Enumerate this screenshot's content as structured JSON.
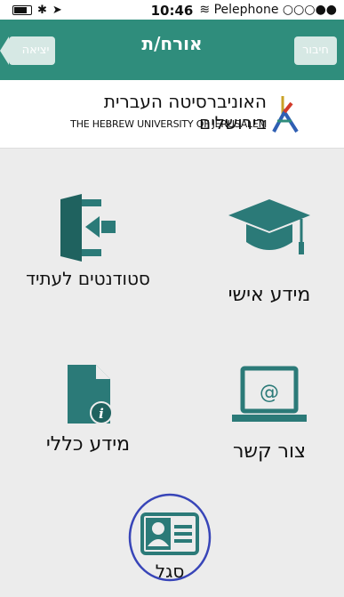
{
  "status": {
    "time": "10:46",
    "carrier": "Pelephone ○○○●●"
  },
  "nav": {
    "title": "אורח/ת",
    "back_label": "יציאה",
    "login_label": "חיבור"
  },
  "header": {
    "heb_name": "האוניברסיטה העברית בירושלים",
    "eng_name": "THE HEBREW UNIVERSITY OF JERUSALEM"
  },
  "tiles": {
    "personal_info": "מידע אישי",
    "future_students": "סטודנטים לעתיד",
    "contact": "צור קשר",
    "general_info": "מידע כללי",
    "staff": "סגל"
  },
  "colors": {
    "brand": "#2f8d7c",
    "icon": "#2b7a78",
    "highlight": "#3845b8"
  }
}
